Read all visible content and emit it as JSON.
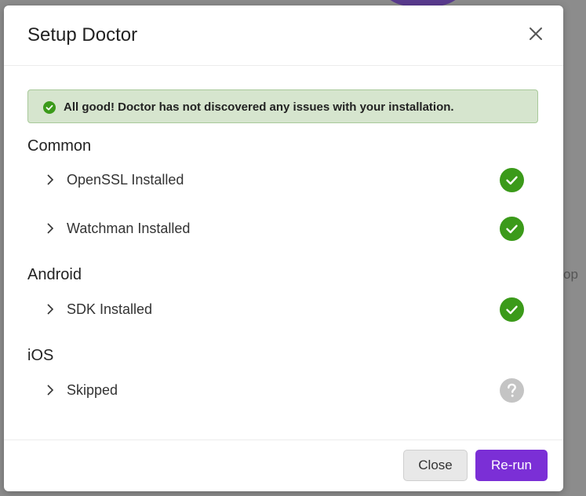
{
  "background": {
    "partial_text": "op"
  },
  "dialog": {
    "title": "Setup Doctor",
    "alert": "All good! Doctor has not discovered any issues with your installation.",
    "sections": [
      {
        "title": "Common",
        "items": [
          {
            "label": "OpenSSL Installed",
            "status": "success"
          },
          {
            "label": "Watchman Installed",
            "status": "success"
          }
        ]
      },
      {
        "title": "Android",
        "items": [
          {
            "label": "SDK Installed",
            "status": "success"
          }
        ]
      },
      {
        "title": "iOS",
        "items": [
          {
            "label": "Skipped",
            "status": "unknown"
          }
        ]
      }
    ],
    "buttons": {
      "close": "Close",
      "rerun": "Re-run"
    }
  },
  "colors": {
    "success": "#3b9a1a",
    "unknown": "#c4c4c4",
    "primary": "#7b2fd6",
    "alert_bg": "#d6e5ce",
    "alert_border": "#a8c99a"
  }
}
